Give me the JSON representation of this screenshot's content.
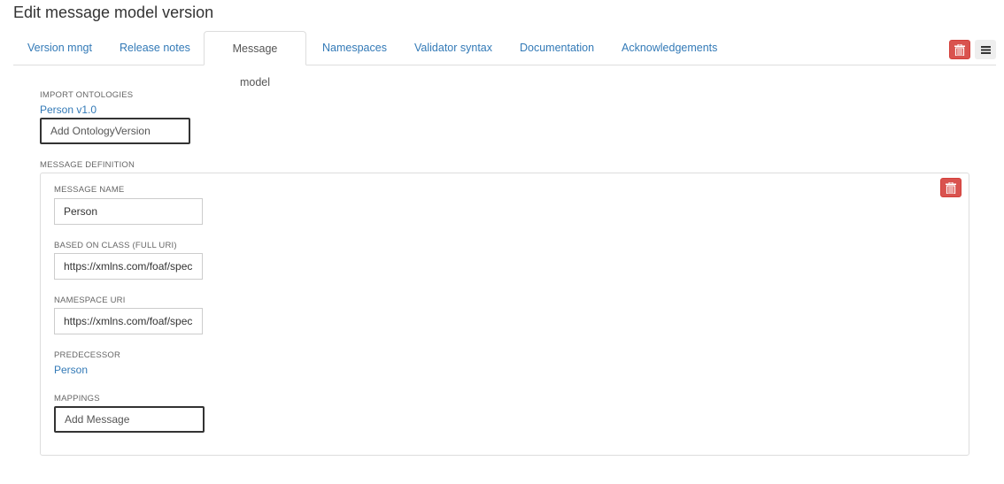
{
  "page": {
    "title": "Edit message model version"
  },
  "tabs": [
    {
      "label": "Version mngt"
    },
    {
      "label": "Release notes"
    },
    {
      "label": "Message model",
      "active": true
    },
    {
      "label": "Namespaces"
    },
    {
      "label": "Validator syntax"
    },
    {
      "label": "Documentation"
    },
    {
      "label": "Acknowledgements"
    }
  ],
  "toolbar": {
    "delete_icon": "trash-icon",
    "menu_icon": "hamburger-icon"
  },
  "imports": {
    "label": "IMPORT ONTOLOGIES",
    "items": [
      "Person v1.0"
    ],
    "add_placeholder": "Add OntologyVersion"
  },
  "definition": {
    "label": "MESSAGE DEFINITION",
    "message_name_label": "MESSAGE NAME",
    "message_name": "Person",
    "based_on_label": "BASED ON CLASS (FULL URI)",
    "based_on": "https://xmlns.com/foaf/spec",
    "namespace_label": "NAMESPACE URI",
    "namespace": "https://xmlns.com/foaf/spec",
    "predecessor_label": "PREDECESSOR",
    "predecessor": "Person",
    "mappings_label": "MAPPINGS",
    "mappings_placeholder": "Add Message"
  },
  "colors": {
    "danger": "#d9534f",
    "link": "#337ab7"
  }
}
